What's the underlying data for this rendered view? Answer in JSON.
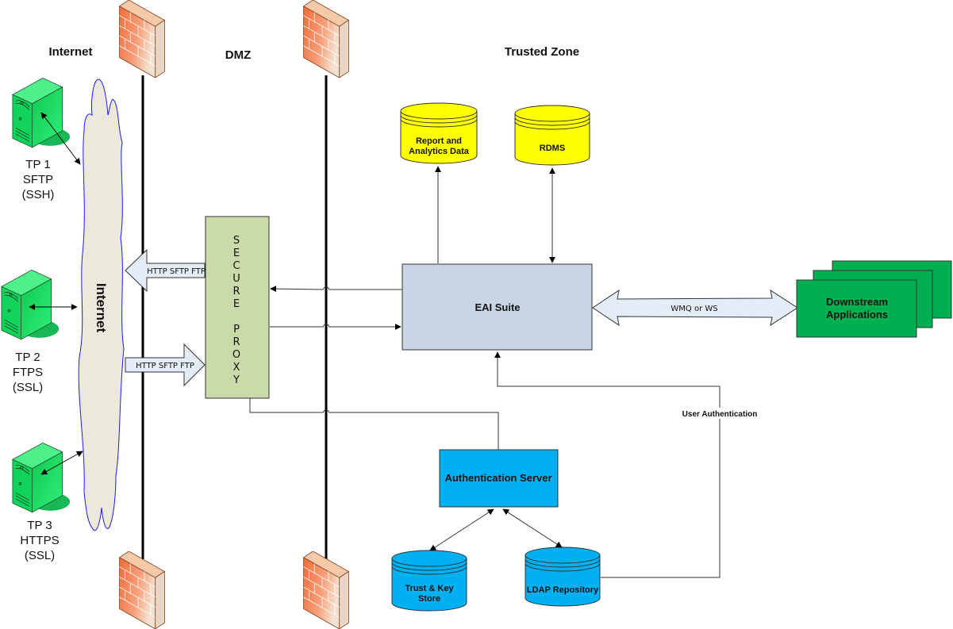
{
  "zones": {
    "internet": "Internet",
    "dmz": "DMZ",
    "trusted": "Trusted Zone"
  },
  "cloud_label": "Internet",
  "trading_partners": [
    {
      "line1": "TP 1",
      "line2": "SFTP",
      "line3": "(SSH)"
    },
    {
      "line1": "TP 2",
      "line2": "FTPS",
      "line3": "(SSL)"
    },
    {
      "line1": "TP 3",
      "line2": "HTTPS",
      "line3": "(SSL)"
    }
  ],
  "protocol_arrows": {
    "outbound": "HTTP SFTP FTP",
    "inbound": "HTTP SFTP FTP"
  },
  "secure_proxy": {
    "letters": [
      "S",
      "E",
      "C",
      "U",
      "R",
      "E",
      " ",
      "P",
      "R",
      "O",
      "X",
      "Y"
    ]
  },
  "eai_suite": "EAI Suite",
  "report_db": {
    "line1": "Report and",
    "line2": "Analytics Data"
  },
  "rdms_db": "RDMS",
  "wmq_link": "WMQ  or WS",
  "downstream": {
    "line1": "Downstream",
    "line2": "Applications"
  },
  "auth_server": "Authentication Server",
  "trust_store": {
    "line1": "Trust & Key",
    "line2": "Store"
  },
  "ldap_repo": "LDAP Repository",
  "user_auth": "User Authentication",
  "colors": {
    "firewall": "#f26d3d",
    "server_green": "#1fd864",
    "cloud_fill": "#ece9dc",
    "cloud_stroke": "#1a1aff",
    "proxy_fill": "#cadaa9",
    "eai_fill": "#c9d5e6",
    "yellow_db": "#ffff00",
    "downstream": "#00b050",
    "auth_blue": "#00b0f0",
    "arrow_fill": "#e4ecf7"
  }
}
